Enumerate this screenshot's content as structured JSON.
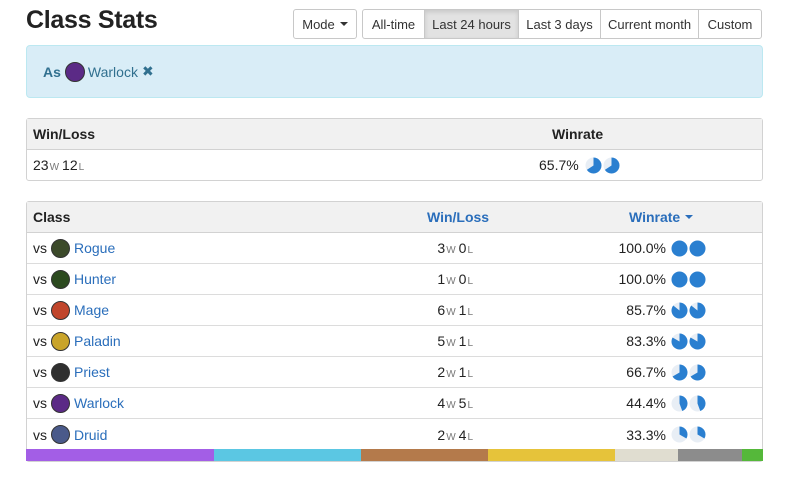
{
  "header": {
    "title": "Class Stats"
  },
  "toolbar": {
    "mode_label": "Mode",
    "time_ranges": [
      {
        "label": "All-time",
        "active": false
      },
      {
        "label": "Last 24 hours",
        "active": true
      },
      {
        "label": "Last 3 days",
        "active": false
      },
      {
        "label": "Current month",
        "active": false
      },
      {
        "label": "Custom",
        "active": false
      }
    ]
  },
  "filter": {
    "prefix": "As",
    "class_name": "Warlock",
    "icon": "warlock-icon",
    "remove_glyph": "✖"
  },
  "summary": {
    "col_winloss": "Win/Loss",
    "col_winrate": "Winrate",
    "wins": "23",
    "losses": "12",
    "win_unit": "W",
    "loss_unit": "L",
    "winrate": "65.7%",
    "winrate_fraction": 0.657
  },
  "table": {
    "col_class": "Class",
    "col_winloss": "Win/Loss",
    "col_winrate": "Winrate",
    "vs_label": "vs",
    "win_unit": "W",
    "loss_unit": "L",
    "rows": [
      {
        "class": "Rogue",
        "icon": "rogue-icon",
        "color": "#3c4a2a",
        "wins": "3",
        "losses": "0",
        "winrate": "100.0%",
        "fraction": 1.0
      },
      {
        "class": "Hunter",
        "icon": "hunter-icon",
        "color": "#2c4a1f",
        "wins": "1",
        "losses": "0",
        "winrate": "100.0%",
        "fraction": 1.0
      },
      {
        "class": "Mage",
        "icon": "mage-icon",
        "color": "#c0452b",
        "wins": "6",
        "losses": "1",
        "winrate": "85.7%",
        "fraction": 0.857
      },
      {
        "class": "Paladin",
        "icon": "paladin-icon",
        "color": "#c9a42a",
        "wins": "5",
        "losses": "1",
        "winrate": "83.3%",
        "fraction": 0.833
      },
      {
        "class": "Priest",
        "icon": "priest-icon",
        "color": "#2f2f2f",
        "wins": "2",
        "losses": "1",
        "winrate": "66.7%",
        "fraction": 0.667
      },
      {
        "class": "Warlock",
        "icon": "warlock-icon",
        "color": "#5b2a86",
        "wins": "4",
        "losses": "5",
        "winrate": "44.4%",
        "fraction": 0.444
      },
      {
        "class": "Druid",
        "icon": "druid-icon",
        "color": "#4a5a8a",
        "wins": "2",
        "losses": "4",
        "winrate": "33.3%",
        "fraction": 0.333
      }
    ]
  },
  "colorbar": [
    {
      "color": "#a35ee6",
      "share": 0.255
    },
    {
      "color": "#5bc7e3",
      "share": 0.2
    },
    {
      "color": "#b47a4b",
      "share": 0.172
    },
    {
      "color": "#e6c33a",
      "share": 0.172
    },
    {
      "color": "#e0ddd0",
      "share": 0.086
    },
    {
      "color": "#8c8c8c",
      "share": 0.086
    },
    {
      "color": "#55b83a",
      "share": 0.029
    }
  ],
  "colors": {
    "link": "#2a6ebb",
    "pie_fill": "#2a7fd0",
    "alert_bg": "#d9edf7"
  }
}
